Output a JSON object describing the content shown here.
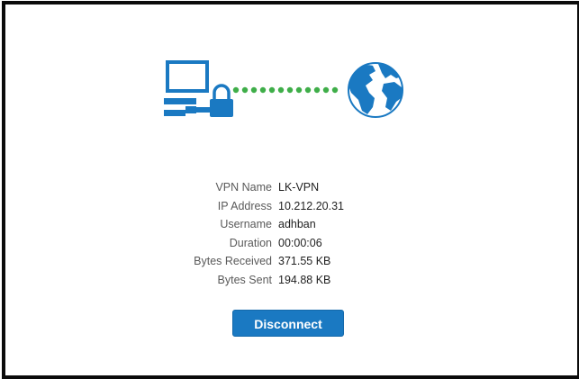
{
  "colors": {
    "accent": "#1a79c2",
    "connection_dots": "#3fae49",
    "border": "#0b0b0b"
  },
  "icons": {
    "computer": "computer-with-lock-icon",
    "connection": "connection-dots",
    "globe": "globe-icon"
  },
  "details": [
    {
      "label": "VPN Name",
      "value": "LK-VPN"
    },
    {
      "label": "IP Address",
      "value": "10.212.20.31"
    },
    {
      "label": "Username",
      "value": "adhban"
    },
    {
      "label": "Duration",
      "value": "00:00:06"
    },
    {
      "label": "Bytes Received",
      "value": "371.55 KB"
    },
    {
      "label": "Bytes Sent",
      "value": "194.88 KB"
    }
  ],
  "actions": {
    "disconnect_label": "Disconnect"
  }
}
